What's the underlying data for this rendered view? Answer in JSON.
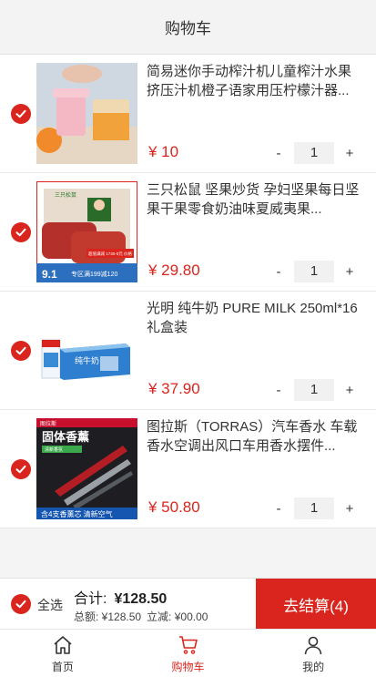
{
  "header": {
    "title": "购物车"
  },
  "items": [
    {
      "name": "简易迷你手动榨汁机儿童榨汁水果挤压汁机橙子语家用压柠檬汁器...",
      "price": "¥ 10",
      "qty": "1",
      "minus": "-",
      "plus": "+",
      "image": "juicer-photo"
    },
    {
      "name": "三只松鼠 坚果炒货 孕妇坚果每日坚果干果零食奶油味夏威夷果...",
      "price": "¥ 29.80",
      "qty": "1",
      "minus": "-",
      "plus": "+",
      "image": "jerky-pack-photo",
      "image_text": {
        "brand": "三只松鼠",
        "promo": "超值满减 1730-0元 价格",
        "price_tag": "9.1",
        "area": "专区满199减120"
      }
    },
    {
      "name": "光明 纯牛奶 PURE MILK 250ml*16 礼盒装",
      "price": "¥ 37.90",
      "qty": "1",
      "minus": "-",
      "plus": "+",
      "image": "milk-box-photo",
      "image_text": {
        "label": "纯牛奶"
      }
    },
    {
      "name": "图拉斯（TORRAS）汽车香水 车载香水空调出风口车用香水摆件...",
      "price": "¥ 50.80",
      "qty": "1",
      "minus": "-",
      "plus": "+",
      "image": "car-perfume-photo",
      "image_text": {
        "brand": "图拉斯",
        "headline": "固体香薰",
        "tag": "清新香氛",
        "footer": "含4支香薰芯 清新空气"
      }
    }
  ],
  "checkout": {
    "select_all": "全选",
    "total_label": "合计:",
    "total_value": "¥128.50",
    "subtotal": "总额: ¥128.50",
    "discount": "立减: ¥00.00",
    "pay_button": "去结算(4)"
  },
  "tabbar": [
    {
      "label": "首页",
      "icon": "home-icon",
      "active": false
    },
    {
      "label": "购物车",
      "icon": "cart-icon",
      "active": true
    },
    {
      "label": "我的",
      "icon": "user-icon",
      "active": false
    }
  ],
  "colors": {
    "accent": "#d9251d",
    "background": "#f4f4f4"
  }
}
